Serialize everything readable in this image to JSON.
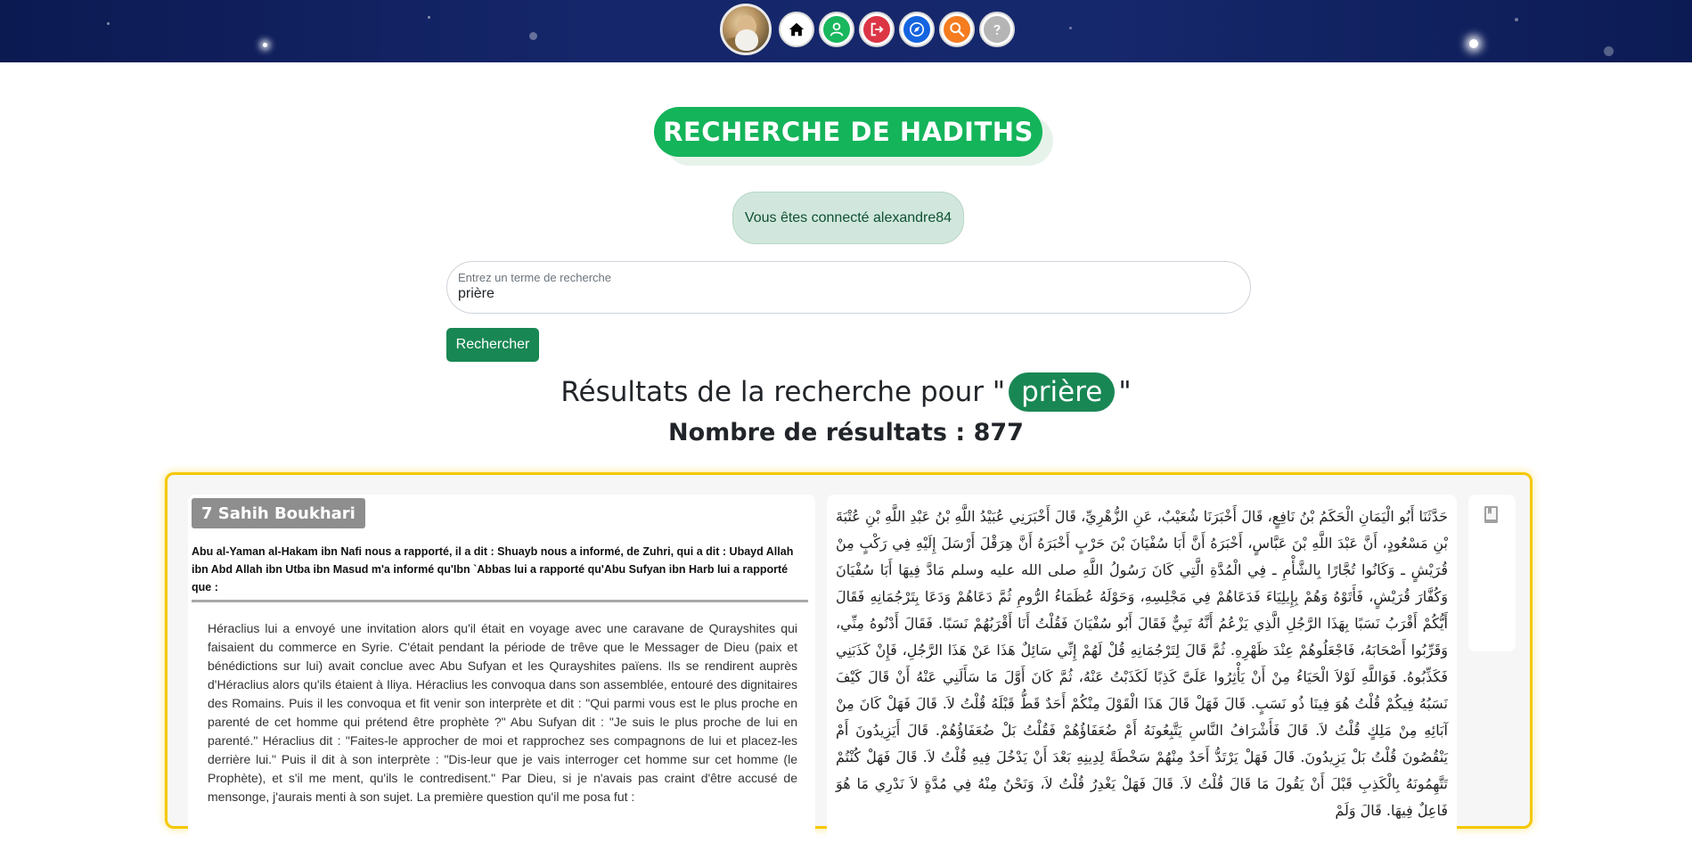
{
  "nav": {
    "items": [
      {
        "icon": "home-icon",
        "color": "#000000"
      },
      {
        "icon": "user-icon",
        "color": "#19b75e"
      },
      {
        "icon": "logout-icon",
        "color": "#dc3545"
      },
      {
        "icon": "compass-icon",
        "color": "#1565e0"
      },
      {
        "icon": "search-icon",
        "color": "#f57c1f"
      },
      {
        "icon": "help-icon",
        "color": "#b5b5b5"
      }
    ]
  },
  "page": {
    "title": "RECHERCHE DE HADITHS",
    "connected_message": "Vous êtes connecté alexandre84"
  },
  "search": {
    "placeholder": "Entrez un terme de recherche",
    "value": "prière",
    "button_label": "Rechercher"
  },
  "results": {
    "prefix": "Résultats de la recherche pour \"",
    "term": "prière",
    "suffix": "\"",
    "count_label": "Nombre de résultats : ",
    "count": "877"
  },
  "hadith": {
    "collection": "7 Sahih Boukhari",
    "isnad": "Abu al-Yaman al-Hakam ibn Nafi nous a rapporté, il a dit : Shuayb nous a informé, de Zuhri, qui a dit : Ubayd Allah ibn Abd Allah ibn Utba ibn Masud m'a informé qu'Ibn `Abbas lui a rapporté qu'Abu Sufyan ibn Harb lui a rapporté que :",
    "matn": "Héraclius lui a envoyé une invitation alors qu'il était en voyage avec une caravane de Qurayshites qui faisaient du commerce en Syrie. C'était pendant la période de trêve que le Messager de Dieu (paix et bénédictions sur lui) avait conclue avec Abu Sufyan et les Qurayshites païens. Ils se rendirent auprès d'Héraclius alors qu'ils étaient à Iliya. Héraclius les convoqua dans son assemblée, entouré des dignitaires des Romains. Puis il les convoqua et fit venir son interprète et dit : \"Qui parmi vous est le plus proche en parenté de cet homme qui prétend être prophète ?\" Abu Sufyan dit : \"Je suis le plus proche de lui en parenté.\" Héraclius dit : \"Faites-le approcher de moi et rapprochez ses compagnons de lui et placez-les derrière lui.\" Puis il dit à son interprète : \"Dis-leur que je vais interroger cet homme sur cet homme (le Prophète), et s'il me ment, qu'ils le contredisent.\" Par Dieu, si je n'avais pas craint d'être accusé de mensonge, j'aurais menti à son sujet. La première question qu'il me posa fut :",
    "arabic": "حَدَّثَنَا أَبُو الْيَمَانِ الْحَكَمُ بْنُ نَافِعٍ، قَالَ أَخْبَرَنَا شُعَيْبٌ، عَنِ الزُّهْرِيِّ، قَالَ أَخْبَرَنِي عُبَيْدُ اللَّهِ بْنُ عَبْدِ اللَّهِ بْنِ عُتْبَةَ بْنِ مَسْعُودٍ، أَنَّ عَبْدَ اللَّهِ بْنَ عَبَّاسٍ، أَخْبَرَهُ أَنَّ أَبَا سُفْيَانَ بْنَ حَرْبٍ أَخْبَرَهُ أَنَّ هِرَقْلَ أَرْسَلَ إِلَيْهِ فِي رَكْبٍ مِنْ قُرَيْشٍ ـ وَكَانُوا تُجَّارًا بِالشَّأْمِ ـ فِي الْمُدَّةِ الَّتِي كَانَ رَسُولُ اللَّهِ صلى الله عليه وسلم مَادَّ فِيهَا أَبَا سُفْيَانَ وَكُفَّارَ قُرَيْشٍ، فَأَتَوْهُ وَهُمْ بِإِيلِيَاءَ فَدَعَاهُمْ فِي مَجْلِسِهِ، وَحَوْلَهُ عُظَمَاءُ الرُّومِ ثُمَّ دَعَاهُمْ وَدَعَا بِتَرْجُمَانِهِ فَقَالَ أَيُّكُمْ أَقْرَبُ نَسَبًا بِهَذَا الرَّجُلِ الَّذِي يَزْعُمُ أَنَّهُ نَبِيٌّ فَقَالَ أَبُو سُفْيَانَ فَقُلْتُ أَنَا أَقْرَبُهُمْ نَسَبًا‏.‏ فَقَالَ أَدْنُوهُ مِنِّي، وَقَرِّبُوا أَصْحَابَهُ، فَاجْعَلُوهُمْ عِنْدَ ظَهْرِهِ‏.‏ ثُمَّ قَالَ لِتَرْجُمَانِهِ قُلْ لَهُمْ إِنِّي سَائِلٌ هَذَا عَنْ هَذَا الرَّجُلِ، فَإِنْ كَذَبَنِي فَكَذِّبُوهُ‏.‏ فَوَاللَّهِ لَوْلاَ الْحَيَاءُ مِنْ أَنْ يَأْثِرُوا عَلَىَّ كَذِبًا لَكَذَبْتُ عَنْهُ، ثُمَّ كَانَ أَوَّلَ مَا سَأَلَنِي عَنْهُ أَنْ قَالَ كَيْفَ نَسَبُهُ فِيكُمْ قُلْتُ هُوَ فِينَا ذُو نَسَبٍ‏.‏ قَالَ فَهَلْ قَالَ هَذَا الْقَوْلَ مِنْكُمْ أَحَدٌ قَطُّ قَبْلَهُ قُلْتُ لاَ‏.‏ قَالَ فَهَلْ كَانَ مِنْ آبَائِهِ مِنْ مَلِكٍ قُلْتُ لاَ‏.‏ قَالَ فَأَشْرَافُ النَّاسِ يَتَّبِعُونَهُ أَمْ ضُعَفَاؤُهُمْ فَقُلْتُ بَلْ ضُعَفَاؤُهُمْ‏.‏ قَالَ أَيَزِيدُونَ أَمْ يَنْقُصُونَ قُلْتُ بَلْ يَزِيدُونَ‏.‏ قَالَ فَهَلْ يَرْتَدُّ أَحَدٌ مِنْهُمْ سَخْطَةً لِدِينِهِ بَعْدَ أَنْ يَدْخُلَ فِيهِ قُلْتُ لاَ‏.‏ قَالَ فَهَلْ كُنْتُمْ تَتَّهِمُونَهُ بِالْكَذِبِ قَبْلَ أَنْ يَقُولَ مَا قَالَ قُلْتُ لاَ‏.‏ قَالَ فَهَلْ يَغْدِرُ قُلْتُ لاَ، وَنَحْنُ مِنْهُ فِي مُدَّةٍ لاَ نَدْرِي مَا هُوَ فَاعِلٌ فِيهَا‏.‏ قَالَ وَلَمْ"
  }
}
